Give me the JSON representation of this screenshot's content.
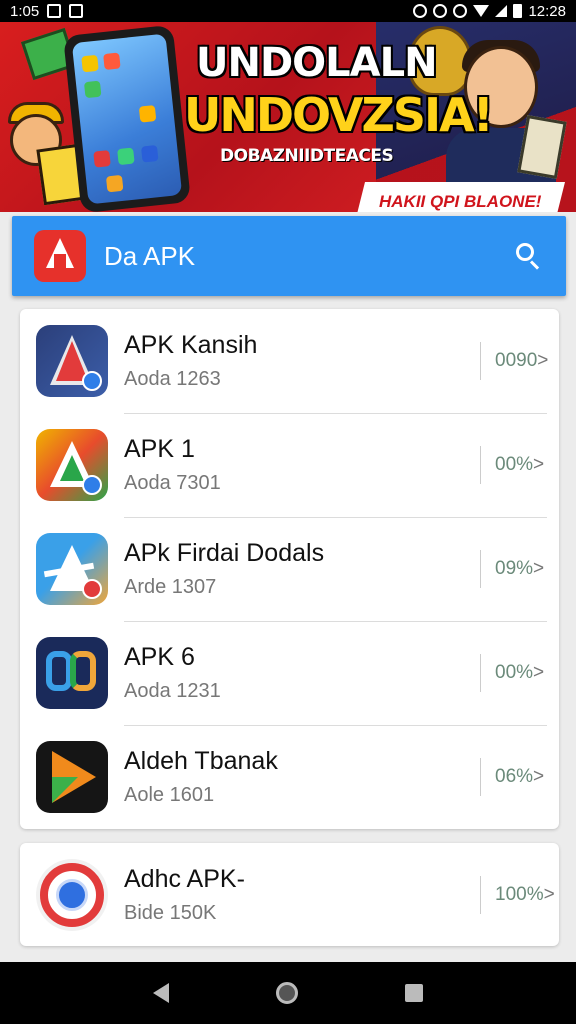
{
  "status_bar": {
    "time": "1:05",
    "clock_right": "12:28"
  },
  "banner": {
    "title_line1": "UNDOLALN",
    "title_line2": "UNDOVZSIA!",
    "subtitle": "DOBAZNIIDTEACES",
    "cta": "HAKII QPI BLAONE!"
  },
  "search": {
    "title": "Da APK",
    "accent_color": "#2f93f2"
  },
  "apps": [
    {
      "name": "APK Kansih",
      "sub": "Aoda 1263",
      "pct": "0090",
      "icon": "apk-red-a-icon"
    },
    {
      "name": "APK 1",
      "sub": "Aoda 7301",
      "pct": "00%",
      "icon": "apk-multicolor-a-icon"
    },
    {
      "name": "APk Firdai Dodals",
      "sub": "Arde 1307",
      "pct": "09%",
      "icon": "apk-blue-a-icon"
    },
    {
      "name": "APK 6",
      "sub": "Aoda 1231",
      "pct": "00%",
      "icon": "apk-as-icon"
    },
    {
      "name": "Aldeh Tbanak",
      "sub": "Aole 1601",
      "pct": "06%",
      "icon": "apk-orange-arrow-icon"
    }
  ],
  "apps_more": [
    {
      "name": "Adhc APK-",
      "sub": "Bide 150K",
      "pct": "100%",
      "icon": "apk-red-circle-icon"
    }
  ],
  "chevron": ">"
}
